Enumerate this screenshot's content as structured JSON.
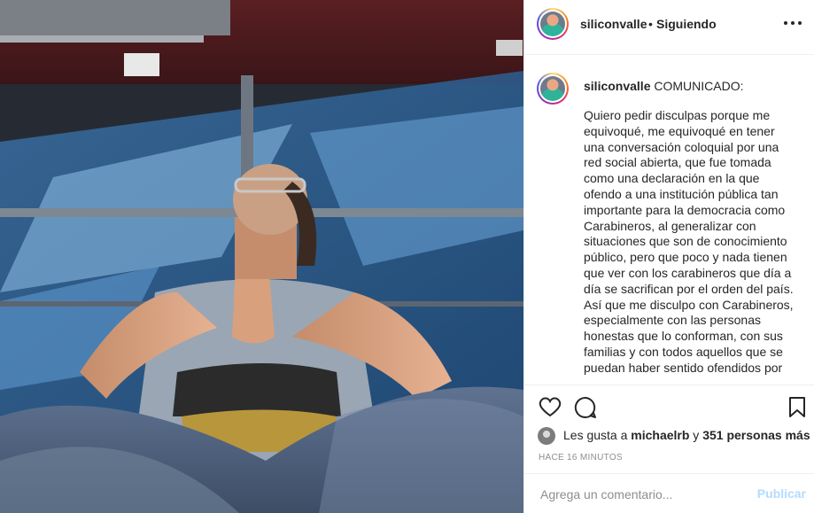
{
  "header": {
    "username": "siliconvalle",
    "separator": "•",
    "follow_status": "Siguiendo",
    "more_icon": "ellipsis-icon"
  },
  "caption": {
    "username": "siliconvalle",
    "title": "COMUNICADO:",
    "body": "Quiero pedir disculpas porque me\nequivoqué, me equivoqué en tener\nuna conversación coloquial por una\nred social abierta, que fue tomada\ncomo una declaración en la que\nofendo a una institución pública tan\nimportante para la democracia como\nCarabineros, al generalizar con\nsituaciones que son de conocimiento\npúblico, pero que poco y nada tienen\nque ver con los carabineros que día a\ndía se sacrifican por el orden del país.\nAsí que me disculpo con Carabineros,\nespecialmente con las personas\nhonestas que lo conforman, con sus\nfamilias y con todos aquellos que se\npuedan haber sentido ofendidos por"
  },
  "actions": {
    "like_icon": "heart-icon",
    "comment_icon": "comment-bubble-icon",
    "save_icon": "bookmark-icon"
  },
  "likes": {
    "prefix": "Les gusta a ",
    "user": "michaelrb",
    "middle": " y ",
    "others": "351 personas más"
  },
  "timestamp": "HACE 16 MINUTOS",
  "comment": {
    "placeholder": "Agrega un comentario...",
    "post_label": "Publicar"
  },
  "colors": {
    "text": "#262626",
    "muted": "#8e8e8e",
    "post_disabled": "#b3dbff",
    "border": "#efefef"
  }
}
